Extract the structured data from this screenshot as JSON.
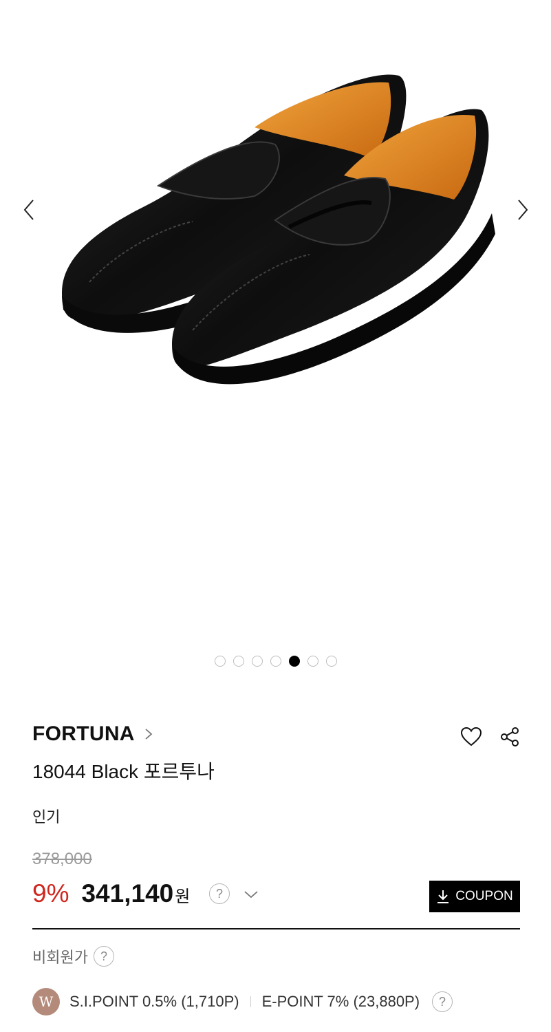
{
  "gallery": {
    "image_alt": "18044 Black 포르투나 penny loafer",
    "dots": [
      {
        "active": false
      },
      {
        "active": false
      },
      {
        "active": false
      },
      {
        "active": false
      },
      {
        "active": true
      },
      {
        "active": false
      },
      {
        "active": false
      }
    ]
  },
  "product": {
    "brand": "FORTUNA",
    "title": "18044 Black 포르투나",
    "tag": "인기",
    "original_price": "378,000",
    "discount": "9%",
    "sale_price": "341,140",
    "currency": "원"
  },
  "coupon": {
    "label": "COUPON"
  },
  "member": {
    "label": "비회원가"
  },
  "points": {
    "badge": "W",
    "si_point": "S.I.POINT 0.5% (1,710P)",
    "e_point": "E-POINT 7% (23,880P)"
  },
  "colors": {
    "discount": "#d0261e",
    "coupon_bg": "#000000",
    "badge_bg": "#b48a7a",
    "active_dot": "#000000"
  },
  "icons": [
    "chevron-left-icon",
    "chevron-right-icon",
    "chevron-right-small-icon",
    "heart-icon",
    "share-icon",
    "help-icon",
    "chevron-down-icon",
    "download-icon"
  ]
}
